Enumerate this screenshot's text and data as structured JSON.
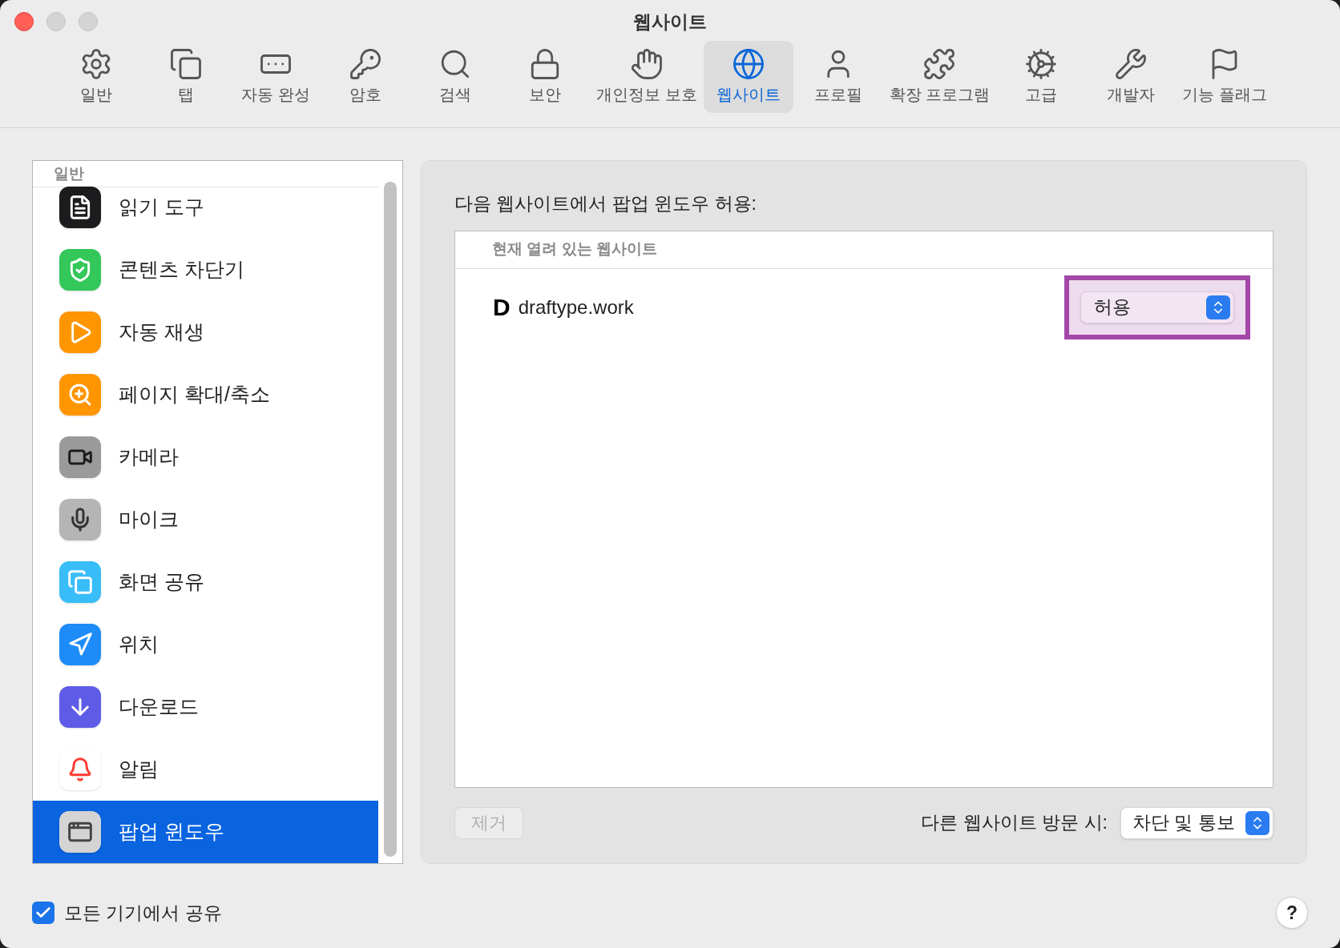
{
  "window": {
    "title": "웹사이트"
  },
  "toolbar": [
    {
      "label": "일반",
      "selected": false
    },
    {
      "label": "탭",
      "selected": false
    },
    {
      "label": "자동 완성",
      "selected": false
    },
    {
      "label": "암호",
      "selected": false
    },
    {
      "label": "검색",
      "selected": false
    },
    {
      "label": "보안",
      "selected": false
    },
    {
      "label": "개인정보 보호",
      "selected": false
    },
    {
      "label": "웹사이트",
      "selected": true
    },
    {
      "label": "프로필",
      "selected": false
    },
    {
      "label": "확장 프로그램",
      "selected": false
    },
    {
      "label": "고급",
      "selected": false
    },
    {
      "label": "개발자",
      "selected": false
    },
    {
      "label": "기능 플래그",
      "selected": false
    }
  ],
  "sidebar": {
    "header": "일반",
    "items": [
      {
        "label": "읽기 도구",
        "selected": false
      },
      {
        "label": "콘텐츠 차단기",
        "selected": false
      },
      {
        "label": "자동 재생",
        "selected": false
      },
      {
        "label": "페이지 확대/축소",
        "selected": false
      },
      {
        "label": "카메라",
        "selected": false
      },
      {
        "label": "마이크",
        "selected": false
      },
      {
        "label": "화면 공유",
        "selected": false
      },
      {
        "label": "위치",
        "selected": false
      },
      {
        "label": "다운로드",
        "selected": false
      },
      {
        "label": "알림",
        "selected": false
      },
      {
        "label": "팝업 윈도우",
        "selected": true
      }
    ]
  },
  "panel": {
    "title": "다음 웹사이트에서 팝업 윈도우 허용:",
    "table": {
      "section_header": "현재 열려 있는 웹사이트",
      "rows": [
        {
          "favicon": "D",
          "site": "draftype.work",
          "setting": "허용",
          "highlighted": true
        }
      ]
    },
    "remove_button": {
      "label": "제거",
      "disabled": true
    },
    "other_sites_label": "다른 웹사이트 방문 시:",
    "other_sites_setting": "차단 및 통보"
  },
  "share_across_devices": {
    "label": "모든 기기에서 공유",
    "checked": true
  },
  "help_button": "?"
}
